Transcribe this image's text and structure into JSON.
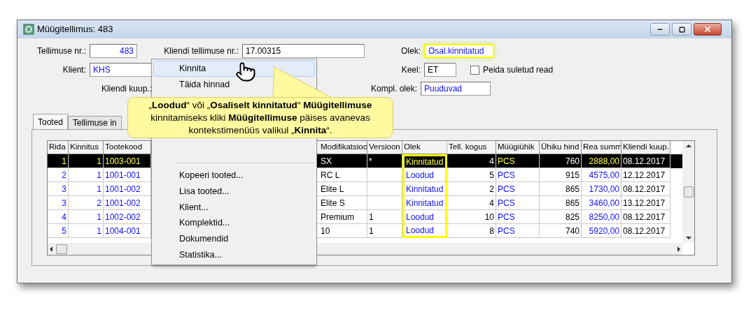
{
  "window": {
    "title": "Müügitellimus: 483"
  },
  "form": {
    "order_no": {
      "label": "Tellimuse nr.:",
      "value": "483"
    },
    "customer_order_no": {
      "label": "Kliendi tellimuse nr.:",
      "value": "17.00315"
    },
    "client": {
      "label": "Klient:",
      "value": "KHS"
    },
    "customer_date": {
      "label": "Kliendi kuup.:"
    },
    "status": {
      "label": "Olek:",
      "value": "Osal.kinnitatud",
      "highlighted": true
    },
    "language": {
      "label": "Keel:",
      "value": "ET"
    },
    "hide_closed": {
      "label": "Peida suletud read",
      "checked": false
    },
    "kit_status": {
      "label": "Kompl. olek:",
      "value": "Puuduvad"
    }
  },
  "tabs": [
    {
      "label": "Tooted",
      "selected": true
    },
    {
      "label": "Tellimuse in",
      "selected": false
    }
  ],
  "table": {
    "columns": [
      {
        "label": "Rida",
        "highlighted": false
      },
      {
        "label": "Kinnitus",
        "highlighted": false
      },
      {
        "label": "Tootekood",
        "highlighted": false
      },
      {
        "label": "Modifikatsioo",
        "highlighted": false
      },
      {
        "label": "Versioon",
        "highlighted": false
      },
      {
        "label": "Olek",
        "highlighted": true
      },
      {
        "label": "Tell. kogus",
        "highlighted": false
      },
      {
        "label": "Müügiühik",
        "highlighted": false
      },
      {
        "label": "Ühiku hind",
        "highlighted": false
      },
      {
        "label": "Rea summ",
        "highlighted": false
      },
      {
        "label": "Kliendi kuup.",
        "highlighted": false
      }
    ],
    "rows": [
      {
        "selected": true,
        "cells": [
          "1",
          "1",
          "1003-001",
          "SX",
          "*",
          "Kinnitatud",
          "4",
          "PCS",
          "760",
          "2888,00",
          "08.12.2017"
        ]
      },
      {
        "selected": false,
        "cells": [
          "2",
          "1",
          "1001-001",
          "RC L",
          "",
          "Loodud",
          "5",
          "PCS",
          "915",
          "4575,00",
          "12.12.2017"
        ]
      },
      {
        "selected": false,
        "cells": [
          "3",
          "1",
          "1001-002",
          "Elite L",
          "",
          "Kinnitatud",
          "2",
          "PCS",
          "865",
          "1730,00",
          "08.12.2017"
        ]
      },
      {
        "selected": false,
        "cells": [
          "3",
          "2",
          "1001-002",
          "Elite S",
          "",
          "Kinnitatud",
          "4",
          "PCS",
          "865",
          "3460,00",
          "13.12.2017"
        ]
      },
      {
        "selected": false,
        "cells": [
          "4",
          "1",
          "1002-002",
          "Premium",
          "1",
          "Loodud",
          "10",
          "PCS",
          "825",
          "8250,00",
          "08.12.2017"
        ]
      },
      {
        "selected": false,
        "cells": [
          "5",
          "1",
          "1004-001",
          "10",
          "1",
          "Loodud",
          "8",
          "PCS",
          "740",
          "5920,00",
          "08.12.2017"
        ]
      }
    ]
  },
  "context_menu": {
    "items": [
      {
        "kind": "item",
        "label": "Kinnita",
        "selected": true
      },
      {
        "kind": "item",
        "label": "Täida hinnad",
        "selected": false
      },
      {
        "kind": "separator"
      },
      {
        "kind": "item",
        "label": "Kopeeri tooted...",
        "selected": false
      },
      {
        "kind": "item",
        "label": "Lisa tooted...",
        "selected": false
      },
      {
        "kind": "item",
        "label": "Klient...",
        "selected": false
      },
      {
        "kind": "item",
        "label": "Komplektid...",
        "selected": false
      },
      {
        "kind": "item",
        "label": "Dokumendid",
        "selected": false
      },
      {
        "kind": "item",
        "label": "Statistika...",
        "selected": false
      }
    ]
  },
  "callout": {
    "text": "„**Loodud**“ või „**Osaliselt kinnitatud**“ **Müügitellimuse** kinnitamiseks kliki **Müügitellimuse** päises avanevas kontekstimenüüs valikul „**Kinnita**“."
  }
}
